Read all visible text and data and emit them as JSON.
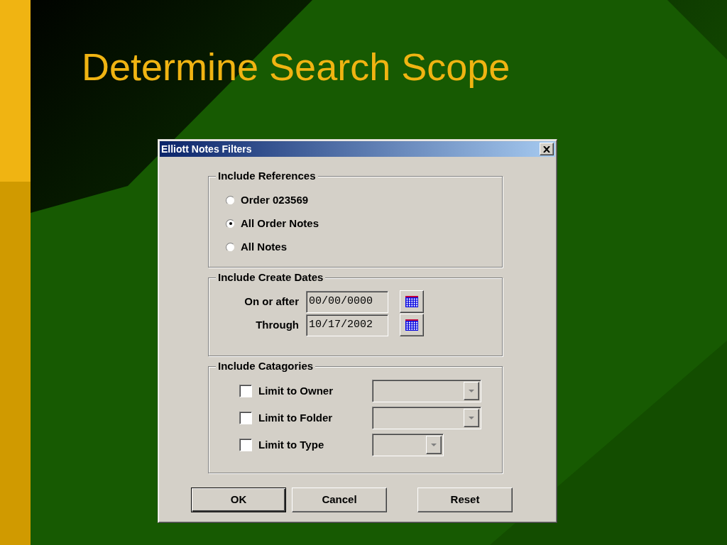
{
  "slide": {
    "title": "Determine Search Scope"
  },
  "dialog": {
    "title": "Elliott Notes Filters",
    "references": {
      "legend": "Include References",
      "options": [
        {
          "label": "Order 023569",
          "selected": false
        },
        {
          "label": "All Order Notes",
          "selected": true
        },
        {
          "label": "All Notes",
          "selected": false
        }
      ]
    },
    "dates": {
      "legend": "Include Create Dates",
      "fields": [
        {
          "label": "On or after",
          "value": "00/00/0000"
        },
        {
          "label": "Through",
          "value": "10/17/2002"
        }
      ]
    },
    "categories": {
      "legend": "Include Catagories",
      "items": [
        {
          "label": "Limit to Owner",
          "checked": false
        },
        {
          "label": "Limit to Folder",
          "checked": false
        },
        {
          "label": "Limit to Type",
          "checked": false
        }
      ]
    },
    "buttons": [
      {
        "label": "OK",
        "default": true
      },
      {
        "label": "Cancel",
        "default": false
      },
      {
        "label": "Reset",
        "default": false
      }
    ]
  }
}
